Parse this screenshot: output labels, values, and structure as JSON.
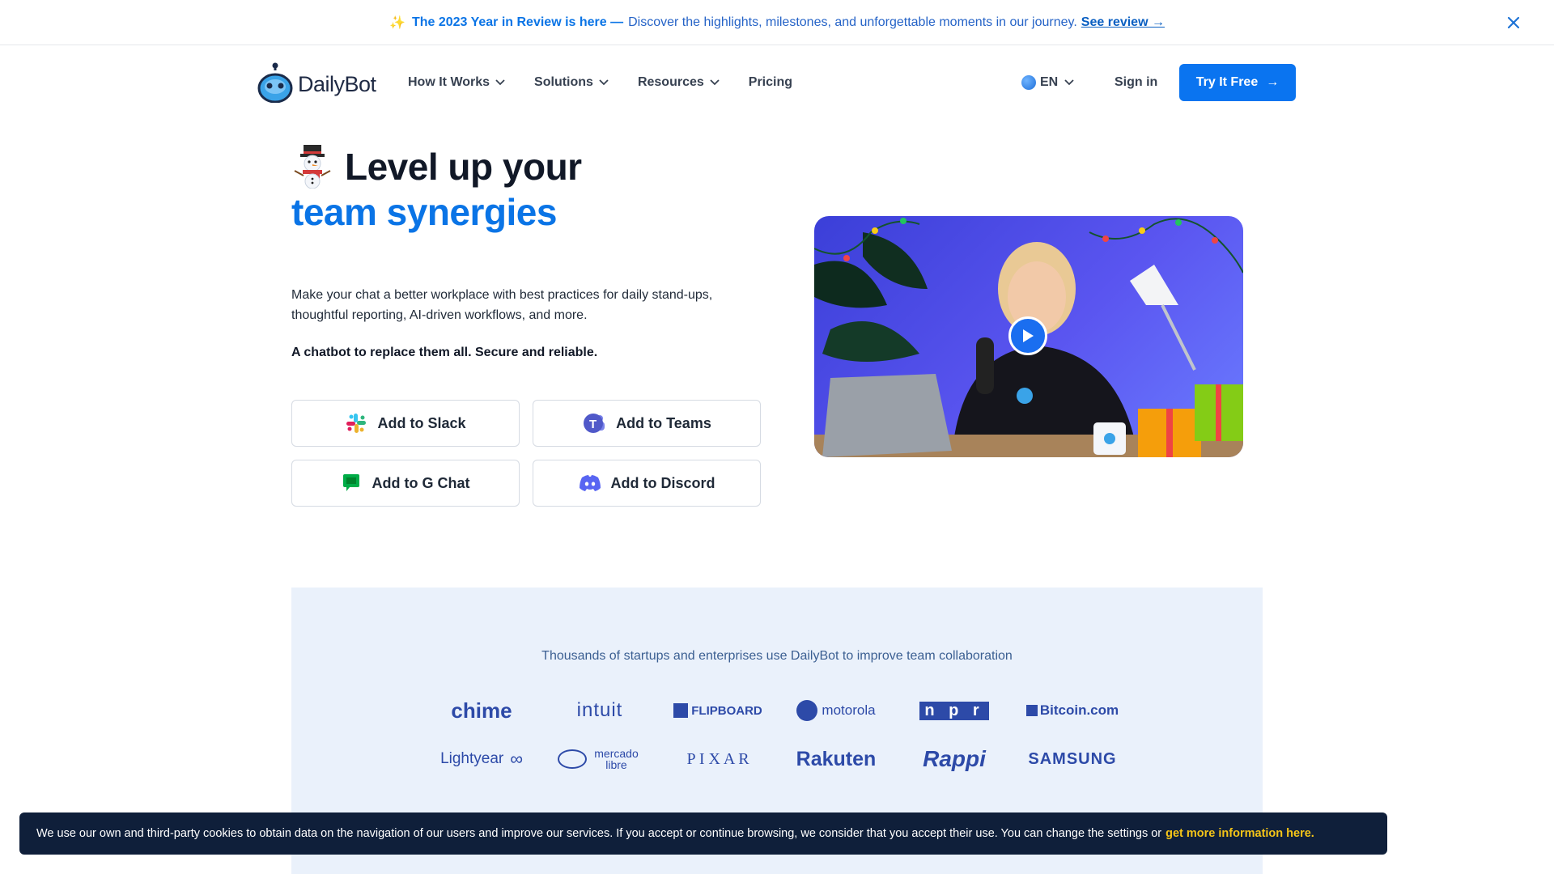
{
  "announcement": {
    "headline": "The 2023 Year in Review is here —",
    "description": "Discover the highlights, milestones, and unforgettable moments in our journey.",
    "link": "See review →"
  },
  "nav": {
    "brand": "DailyBot",
    "items": [
      {
        "label": "How It Works",
        "dropdown": true
      },
      {
        "label": "Solutions",
        "dropdown": true
      },
      {
        "label": "Resources",
        "dropdown": true
      },
      {
        "label": "Pricing",
        "dropdown": false
      }
    ],
    "language": "EN",
    "signin": "Sign in",
    "cta": "Try It Free",
    "cta_arrow": "→"
  },
  "hero": {
    "title_line1": "Level up your",
    "title_line2": "team synergies",
    "description": "Make your chat a better workplace with best practices for daily stand-ups, thoughtful reporting, AI-driven workflows, and more.",
    "tagline": "A chatbot to replace them all. Secure and reliable.",
    "buttons": {
      "slack": "Add to Slack",
      "teams": "Add to Teams",
      "gchat": "Add to G Chat",
      "discord": "Add to Discord"
    }
  },
  "logos": {
    "caption": "Thousands of startups and enterprises use DailyBot to improve team collaboration",
    "row1": [
      "chime",
      "intuit",
      "FLIPBOARD",
      "motorola",
      "n p r",
      "Bitcoin.com"
    ],
    "row2": [
      "Lightyear",
      "mercado libre",
      "P I X A R",
      "Rakuten",
      "Rappi",
      "SAMSUNG"
    ]
  },
  "cookie": {
    "text": "We use our own and third-party cookies to obtain data on the navigation of our users and improve our services. If you accept or continue browsing, we consider that you accept their use. You can change the settings or",
    "link": "get more information here."
  },
  "colors": {
    "brand_blue": "#0a74f0",
    "heading_dark": "#111827",
    "section_bg": "#eaf1fb",
    "cookie_bg": "#0f1f3a",
    "cookie_link": "#f5c518"
  }
}
